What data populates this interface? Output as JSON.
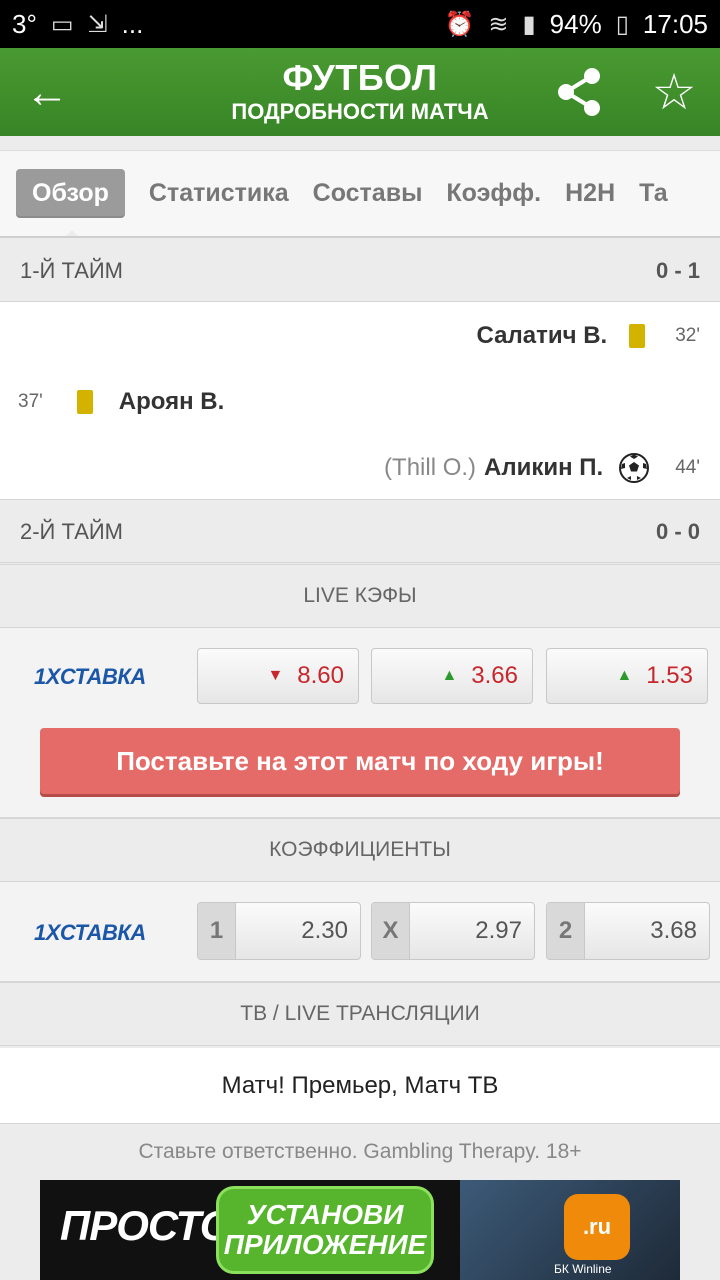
{
  "status_bar": {
    "left_text": "3°",
    "more": "...",
    "battery": "94%",
    "time": "17:05"
  },
  "header": {
    "title": "ФУТБОЛ",
    "subtitle": "ПОДРОБНОСТИ МАТЧА"
  },
  "tabs": [
    {
      "label": "Обзор",
      "active": true
    },
    {
      "label": "Статистика"
    },
    {
      "label": "Составы"
    },
    {
      "label": "Коэфф."
    },
    {
      "label": "H2H"
    },
    {
      "label": "Та"
    }
  ],
  "first_half": {
    "label": "1-Й ТАЙМ",
    "score": "0 - 1"
  },
  "events": [
    {
      "side": "right",
      "player": "Салатич В.",
      "type": "yellow-card",
      "minute": "32'"
    },
    {
      "side": "left",
      "player": "Ароян В.",
      "type": "yellow-card",
      "minute": "37'"
    },
    {
      "side": "right",
      "player": "Аликин П.",
      "assist": "(Thill O.)",
      "type": "goal",
      "minute": "44'"
    }
  ],
  "second_half": {
    "label": "2-Й ТАЙМ",
    "score": "0 - 0"
  },
  "live_odds": {
    "header": "LIVE КЭФЫ",
    "bookmaker": "1XСТАВКА",
    "odds": [
      {
        "value": "8.60",
        "trend": "down"
      },
      {
        "value": "3.66",
        "trend": "up"
      },
      {
        "value": "1.53",
        "trend": "up"
      }
    ],
    "cta": "Поставьте на этот матч по ходу игры!"
  },
  "coefficients": {
    "header": "КОЭФФИЦИЕНТЫ",
    "bookmaker": "1XСТАВКА",
    "items": [
      {
        "label": "1",
        "value": "2.30"
      },
      {
        "label": "X",
        "value": "2.97"
      },
      {
        "label": "2",
        "value": "3.68"
      }
    ]
  },
  "tv": {
    "header": "ТВ / LIVE ТРАНСЛЯЦИИ",
    "channels": "Матч! Премьер, Матч ТВ"
  },
  "disclaimer": "Ставьте ответственно. Gambling Therapy. 18+",
  "banner": {
    "left": "ПРОСТО",
    "button_line1": "УСТАНОВИ",
    "button_line2": "ПРИЛОЖЕНИЕ",
    "app_icon": ".ru",
    "app_label": "БК Winline"
  },
  "colors": {
    "header_green": "#3f8f2a",
    "odds_red": "#c8262c",
    "arrow_green": "#2c9a2a",
    "cta": "#e46b67",
    "brand_blue": "#1a57a8",
    "yellow_card": "#d4b300"
  }
}
